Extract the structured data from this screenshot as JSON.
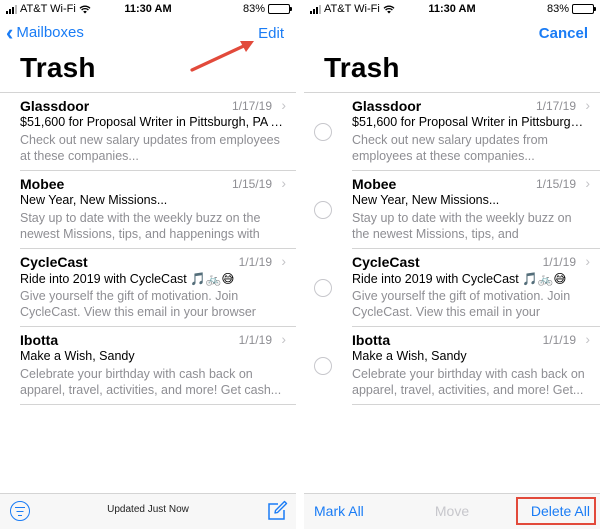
{
  "status": {
    "carrier": "AT&T Wi-Fi",
    "time": "11:30 AM",
    "battery": "83%",
    "battery_level": 0.83
  },
  "left": {
    "back_label": "Mailboxes",
    "edit_label": "Edit",
    "title": "Trash",
    "messages": [
      {
        "sender": "Glassdoor",
        "date": "1/17/19",
        "subject": "$51,600 for Proposal Writer in Pittsburgh, PA A...",
        "preview": "Check out new salary updates from employees at these companies..."
      },
      {
        "sender": "Mobee",
        "date": "1/15/19",
        "subject": "New Year, New Missions...",
        "preview": "Stay up to date with the weekly buzz on the newest Missions, tips, and happenings with M..."
      },
      {
        "sender": "CycleCast",
        "date": "1/1/19",
        "subject": "Ride into 2019 with CycleCast 🎵🚲😅",
        "preview": "Give yourself the gift of motivation. Join CycleCast. View this email in your browser Rid..."
      },
      {
        "sender": "Ibotta",
        "date": "1/1/19",
        "subject": "Make a Wish, Sandy",
        "preview": "Celebrate your birthday with cash back on apparel, travel, activities, and more! Get cash..."
      }
    ],
    "updated_label": "Updated Just Now"
  },
  "right": {
    "cancel_label": "Cancel",
    "title": "Trash",
    "messages": [
      {
        "sender": "Glassdoor",
        "date": "1/17/19",
        "subject": "$51,600 for Proposal Writer in Pittsburgh,...",
        "preview": "Check out new salary updates from employees at these companies..."
      },
      {
        "sender": "Mobee",
        "date": "1/15/19",
        "subject": "New Year, New Missions...",
        "preview": "Stay up to date with the weekly buzz on the newest Missions, tips, and happenings..."
      },
      {
        "sender": "CycleCast",
        "date": "1/1/19",
        "subject": "Ride into 2019 with CycleCast 🎵🚲😅",
        "preview": "Give yourself the gift of motivation. Join CycleCast. View this email in your browser..."
      },
      {
        "sender": "Ibotta",
        "date": "1/1/19",
        "subject": "Make a Wish, Sandy",
        "preview": "Celebrate your birthday with cash back on apparel, travel, activities, and more! Get..."
      }
    ],
    "mark_all_label": "Mark All",
    "move_label": "Move",
    "delete_all_label": "Delete All"
  },
  "colors": {
    "accent": "#1a7cf5",
    "annotation": "#e24a3b",
    "secondary_text": "#8e8e93"
  },
  "icons": {
    "back": "chevron-left-icon",
    "filter": "filter-icon",
    "compose": "compose-icon",
    "disclosure": "chevron-right-icon",
    "annotation_arrow": "arrow-icon"
  }
}
